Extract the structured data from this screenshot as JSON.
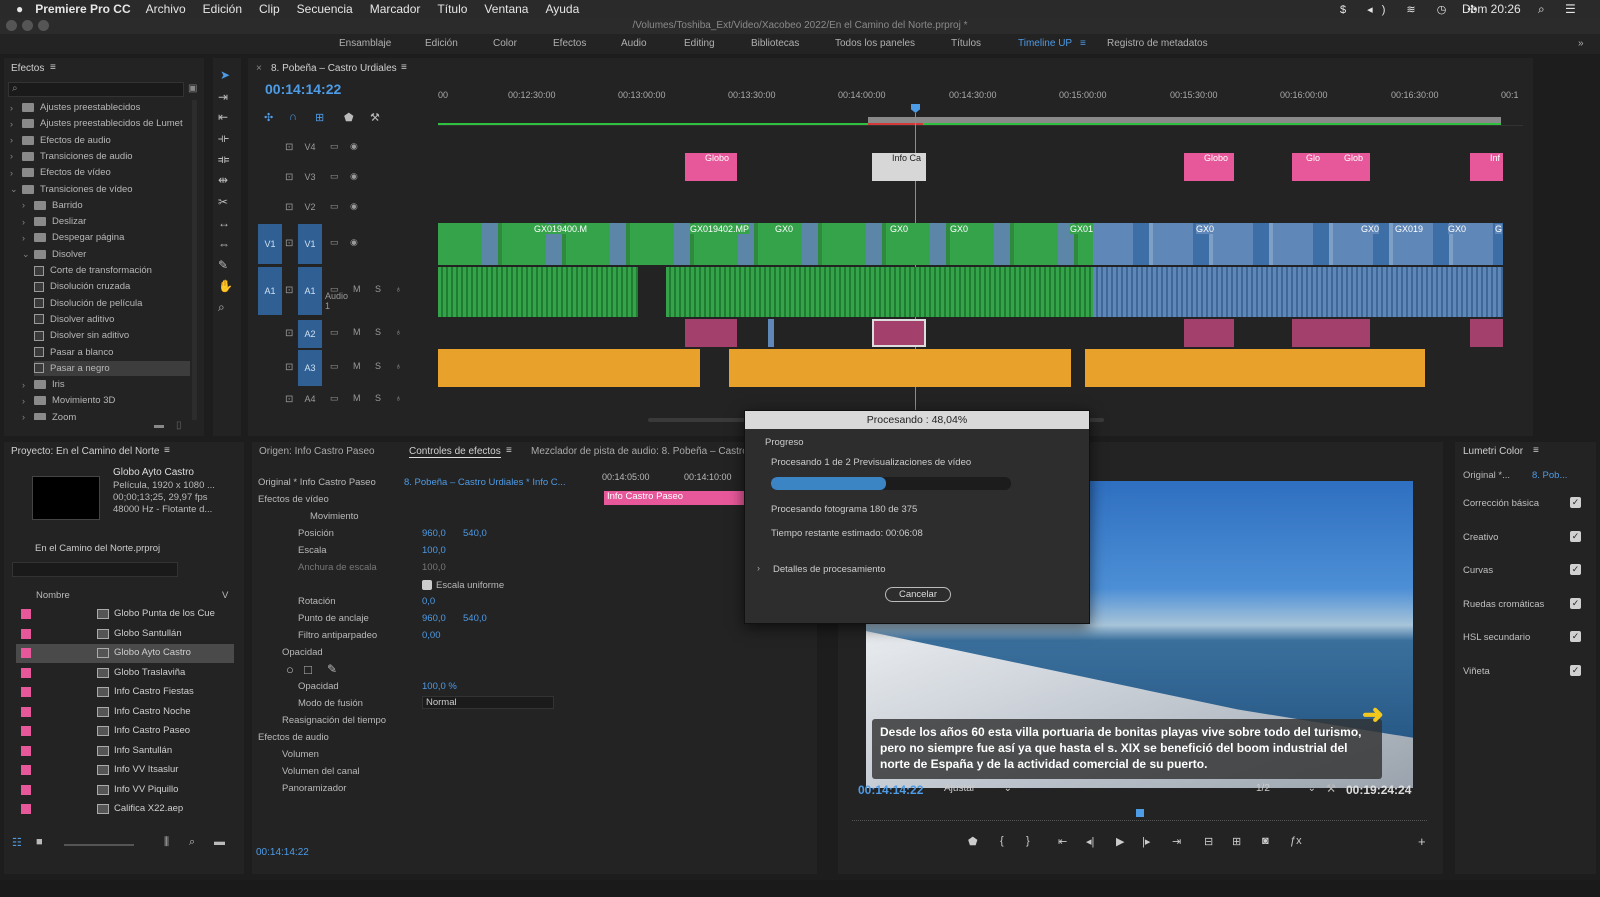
{
  "menubar": {
    "app": "Premiere Pro CC",
    "items": [
      "Archivo",
      "Edición",
      "Clip",
      "Secuencia",
      "Marcador",
      "Título",
      "Ventana",
      "Ayuda"
    ],
    "clock": "Dom 20:26"
  },
  "window": {
    "title": "/Volumes/Toshiba_Ext/Video/Xacobeo 2022/En el Camino del Norte.prproj *"
  },
  "workspaces": [
    "Ensamblaje",
    "Edición",
    "Color",
    "Efectos",
    "Audio",
    "Editing",
    "Bibliotecas",
    "Todos los paneles",
    "Títulos",
    "Timeline UP",
    "Registro de metadatos"
  ],
  "active_workspace": "Timeline UP",
  "effects": {
    "title": "Efectos",
    "items": [
      {
        "label": "Ajustes preestablecidos",
        "kind": "folder",
        "indent": 0,
        "open": false
      },
      {
        "label": "Ajustes preestablecidos de Lumet",
        "kind": "folder",
        "indent": 0,
        "open": false
      },
      {
        "label": "Efectos de audio",
        "kind": "folder",
        "indent": 0,
        "open": false
      },
      {
        "label": "Transiciones de audio",
        "kind": "folder",
        "indent": 0,
        "open": false
      },
      {
        "label": "Efectos de vídeo",
        "kind": "folder",
        "indent": 0,
        "open": false
      },
      {
        "label": "Transiciones de vídeo",
        "kind": "folder",
        "indent": 0,
        "open": true
      },
      {
        "label": "Barrido",
        "kind": "folder",
        "indent": 1,
        "open": false
      },
      {
        "label": "Deslizar",
        "kind": "folder",
        "indent": 1,
        "open": false
      },
      {
        "label": "Despegar página",
        "kind": "folder",
        "indent": 1,
        "open": false
      },
      {
        "label": "Disolver",
        "kind": "folder",
        "indent": 1,
        "open": true
      },
      {
        "label": "Corte de transformación",
        "kind": "fx",
        "indent": 2
      },
      {
        "label": "Disolución cruzada",
        "kind": "fx",
        "indent": 2
      },
      {
        "label": "Disolución de película",
        "kind": "fx",
        "indent": 2
      },
      {
        "label": "Disolver aditivo",
        "kind": "fx",
        "indent": 2
      },
      {
        "label": "Disolver sin aditivo",
        "kind": "fx",
        "indent": 2
      },
      {
        "label": "Pasar a blanco",
        "kind": "fx",
        "indent": 2
      },
      {
        "label": "Pasar a negro",
        "kind": "fx",
        "indent": 2,
        "selected": true
      },
      {
        "label": "Iris",
        "kind": "folder",
        "indent": 1,
        "open": false
      },
      {
        "label": "Movimiento 3D",
        "kind": "folder",
        "indent": 1,
        "open": false
      },
      {
        "label": "Zoom",
        "kind": "folder",
        "indent": 1,
        "open": false
      }
    ]
  },
  "timeline": {
    "tab": "8. Pobeña – Castro Urdiales",
    "timecode": "00:14:14:22",
    "ruler": [
      "00:12:30:00",
      "00:13:00:00",
      "00:13:30:00",
      "00:14:00:00",
      "00:14:30:00",
      "00:15:00:00",
      "00:15:30:00",
      "00:16:00:00",
      "00:16:30:00"
    ],
    "ruler_left": "00",
    "ruler_right": "00:1",
    "tracks": [
      "V4",
      "V3",
      "V2",
      "V1",
      "A1",
      "A2",
      "A3",
      "A4"
    ],
    "src_v1": "V1",
    "src_a1": "A1",
    "audio_track_name": "Audio 1",
    "clips_v3": [
      "Globo",
      "Info Ca",
      "Globo",
      "Glo",
      "Glob",
      "Inf"
    ],
    "clips_v1": [
      "GX019400.M",
      "GX019402.MP",
      "GX0",
      "GX0",
      "GX0",
      "GX01",
      "GX0",
      "GX0",
      "GX019",
      "GX0",
      "G"
    ]
  },
  "project": {
    "title": "Proyecto: En el Camino del Norte",
    "clip_name": "Globo Ayto Castro",
    "clip_info": [
      "Película, 1920 x 1080 ...",
      "00;00;13;25, 29,97 fps",
      "48000 Hz - Flotante d..."
    ],
    "file": "En el Camino del Norte.prproj",
    "col_name": "Nombre",
    "col_v": "V",
    "items": [
      "Globo Punta de los Cue",
      "Globo Santullán",
      "Globo Ayto Castro",
      "Globo Traslaviña",
      "Info Castro Fiestas",
      "Info Castro Noche",
      "Info Castro Paseo",
      "Info Santullán",
      "Info VV Itsaslur",
      "Info VV Piquillo",
      "Califica X22.aep"
    ]
  },
  "effect_controls": {
    "tabs": [
      "Origen: Info Castro Paseo",
      "Controles de efectos",
      "Mezclador de pista de audio: 8. Pobeña – Castro"
    ],
    "master": "Original * Info Castro Paseo",
    "seq": "8. Pobeña – Castro Urdiales * Info C...",
    "tc1": "00:14:05:00",
    "tc2": "00:14:10:00",
    "mini_clip": "Info Castro Paseo",
    "video_effects": "Efectos de vídeo",
    "movimiento": "Movimiento",
    "rows": [
      {
        "label": "Posición",
        "v1": "960,0",
        "v2": "540,0"
      },
      {
        "label": "Escala",
        "v1": "100,0",
        "v2": ""
      },
      {
        "label": "Anchura de escala",
        "v1": "100,0",
        "v2": ""
      }
    ],
    "uniform": "Escala uniforme",
    "rows2": [
      {
        "label": "Rotación",
        "v1": "0,0",
        "v2": ""
      },
      {
        "label": "Punto de anclaje",
        "v1": "960,0",
        "v2": "540,0"
      },
      {
        "label": "Filtro antiparpadeo",
        "v1": "0,00",
        "v2": ""
      }
    ],
    "opacidad": "Opacidad",
    "op_label": "Opacidad",
    "op_value": "100,0 %",
    "blend_label": "Modo de fusión",
    "blend_value": "Normal",
    "remap": "Reasignación del tiempo",
    "audio_effects": "Efectos de audio",
    "audio_rows": [
      "Volumen",
      "Volumen del canal",
      "Panoramizador"
    ],
    "bottom_tc": "00:14:14:22"
  },
  "program": {
    "caption": "Desde los años 60 esta villa portuaria de bonitas playas vive sobre todo del turismo, pero no siempre fue así ya que hasta el s. XIX se benefició del boom industrial del norte de España y de la actividad comercial de su puerto.",
    "timecode": "00:14:14:22",
    "fit": "Ajustar",
    "res": "1/2",
    "duration": "00:19:24:24"
  },
  "lumetri": {
    "title": "Lumetri Color",
    "master": "Original *...",
    "seq": "8. Pob...",
    "items": [
      "Corrección básica",
      "Creativo",
      "Curvas",
      "Ruedas cromáticas",
      "HSL secundario",
      "Viñeta"
    ]
  },
  "dialog": {
    "title": "Procesando : 48,04%",
    "progress_label": "Progreso",
    "line1": "Procesando 1 de 2 Previsualizaciones de vídeo",
    "progress": 0.48,
    "line2": "Procesando fotograma 180 de 375",
    "line3": "Tiempo restante estimado: 00:06:08",
    "details": "Detalles de procesamiento",
    "cancel": "Cancelar"
  },
  "colors": {
    "accent": "#4e9be6",
    "pink": "#e7589a",
    "green": "#35a34a",
    "orange": "#e8a12a",
    "blue_clip": "#5f87b8"
  }
}
